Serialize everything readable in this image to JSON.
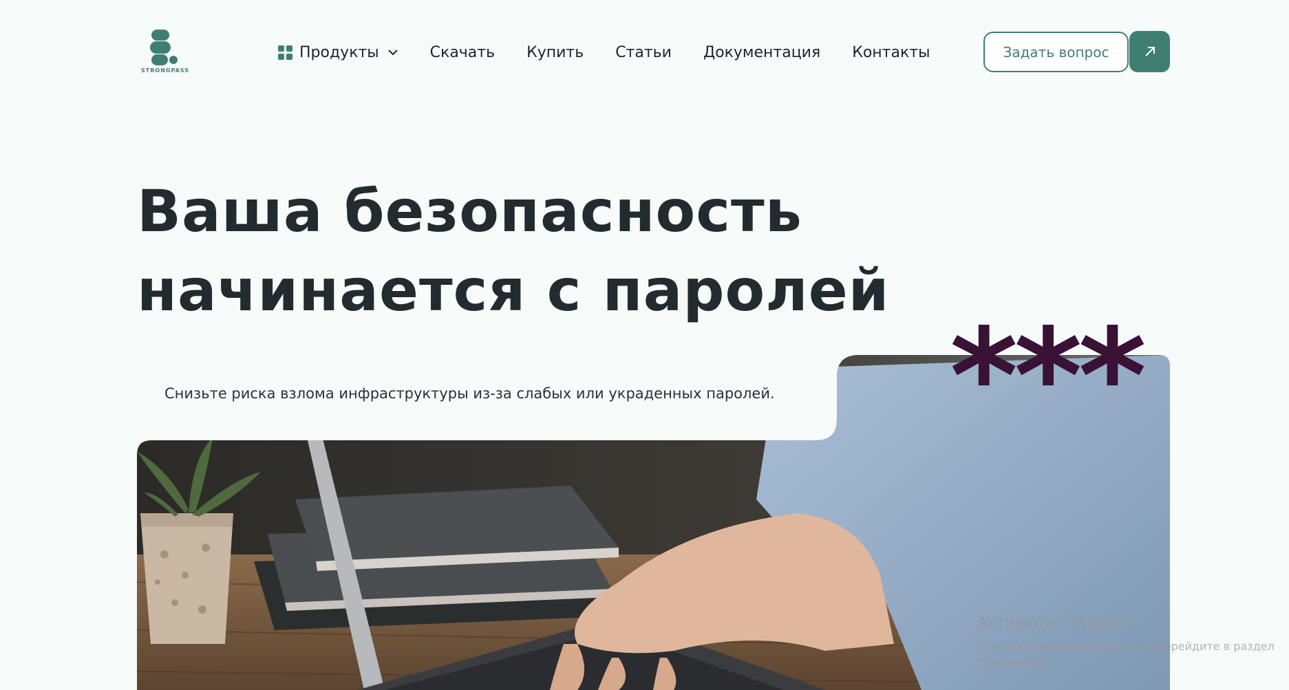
{
  "header": {
    "logo_text": "STRONGPASS",
    "nav": {
      "products": "Продукты",
      "download": "Скачать",
      "buy": "Купить",
      "articles": "Статьи",
      "docs": "Документация",
      "contacts": "Контакты"
    },
    "ask_button": "Задать вопрос",
    "accent_color": "#3f7f73"
  },
  "hero": {
    "title_line1": "Ваша безопасность",
    "title_line2": "начинается с паролей",
    "stars": "***",
    "subtitle": "Снизьте риска взлома инфраструктуры из-за слабых или украденных паролей.",
    "photo": "laptop-typing-photo"
  },
  "watermark": {
    "line1": "Активация Windows",
    "line2": "Чтобы активировать Windows, перейдите в раздел \"Параметры\"."
  },
  "icons": [
    "grid-icon",
    "chevron-down-icon",
    "arrow-up-right-icon"
  ]
}
